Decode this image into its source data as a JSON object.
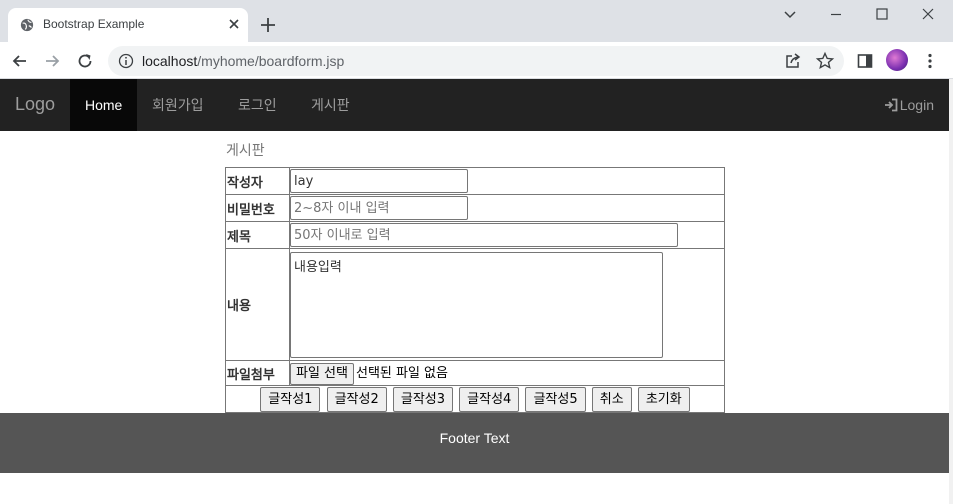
{
  "browser": {
    "tab_title": "Bootstrap Example",
    "url_host": "localhost",
    "url_path": "/myhome/boardform.jsp"
  },
  "navbar": {
    "brand": "Logo",
    "items": [
      {
        "label": "Home",
        "active": true
      },
      {
        "label": "회원가입",
        "active": false
      },
      {
        "label": "로그인",
        "active": false
      },
      {
        "label": "게시판",
        "active": false
      }
    ],
    "login_label": "Login"
  },
  "main": {
    "heading": "게시판",
    "form": {
      "writer_label": "작성자",
      "writer_value": "lay",
      "password_label": "비밀번호",
      "password_placeholder": "2~8자 이내 입력",
      "subject_label": "제목",
      "subject_placeholder": "50자 이내로 입력",
      "content_label": "내용",
      "content_value": "내용입력",
      "file_label": "파일첨부",
      "file_button": "파일 선택",
      "file_status": "선택된 파일 없음",
      "buttons": [
        "글작성1",
        "글작성2",
        "글작성3",
        "글작성4",
        "글작성5",
        "취소",
        "초기화"
      ]
    }
  },
  "footer": {
    "text": "Footer Text"
  },
  "colors": {
    "navbar_bg": "#222222",
    "navbar_active_bg": "#080808",
    "footer_bg": "#555555"
  }
}
